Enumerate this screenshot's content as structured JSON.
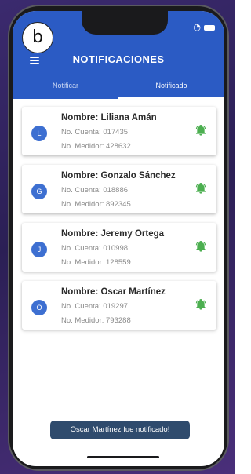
{
  "corner_label": "b",
  "header": {
    "title": "NOTIFICACIONES",
    "tabs": [
      {
        "label": "Notificar",
        "active": false
      },
      {
        "label": "Notificado",
        "active": true
      }
    ]
  },
  "cards": [
    {
      "initial": "L",
      "name": "Nombre: Liliana Amán",
      "account": "No. Cuenta: 017435",
      "meter": "No. Medidor: 428632"
    },
    {
      "initial": "G",
      "name": "Nombre: Gonzalo Sánchez",
      "account": "No. Cuenta: 018886",
      "meter": "No. Medidor: 892345"
    },
    {
      "initial": "J",
      "name": "Nombre: Jeremy Ortega",
      "account": "No. Cuenta: 010998",
      "meter": "No. Medidor: 128559"
    },
    {
      "initial": "O",
      "name": "Nombre: Oscar Martínez",
      "account": "No. Cuenta: 019297",
      "meter": "No. Medidor: 793288"
    }
  ],
  "toast": "Oscar Martínez fue notificado!",
  "colors": {
    "primary": "#2b5bc4",
    "avatar": "#3d6fd1",
    "bell": "#4caf50",
    "toast_bg": "#2f4b6d"
  },
  "icons": {
    "menu": "hamburger-menu-icon",
    "bell": "bell-ringing-icon",
    "wifi": "wifi-icon",
    "battery": "battery-icon"
  }
}
